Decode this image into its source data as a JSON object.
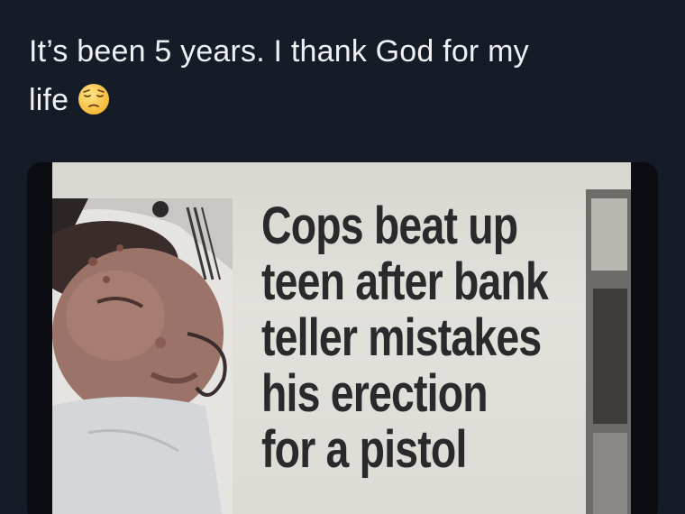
{
  "tweet": {
    "text_line1": "It’s been 5 years. I thank God for my",
    "text_line2": "life",
    "emoji": "pensive-face-emoji"
  },
  "media": {
    "headline": [
      "Cops beat up",
      "teen after bank",
      "teller mistakes",
      "his erection",
      "for a pistol"
    ]
  }
}
